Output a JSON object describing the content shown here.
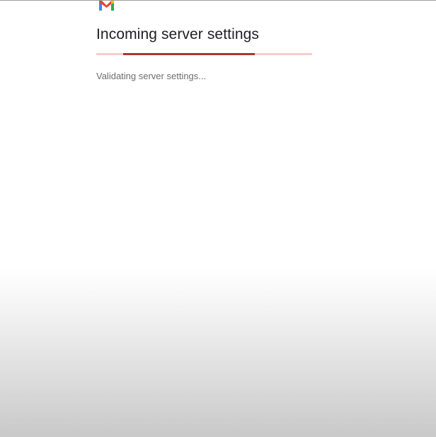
{
  "app": {
    "logo_icon": "gmail-logo-icon"
  },
  "header": {
    "title": "Incoming server settings"
  },
  "progress": {
    "indeterminate": true,
    "segment_start_fraction": 0.125,
    "segment_end_fraction": 0.735,
    "track_color": "#f3cfcf",
    "fill_color": "#b3342f"
  },
  "status": {
    "message": "Validating server settings..."
  },
  "colors": {
    "gmail_red": "#ea4335",
    "gmail_blue": "#4285f4",
    "gmail_green": "#34a853",
    "gmail_yellow": "#fbbc04"
  }
}
